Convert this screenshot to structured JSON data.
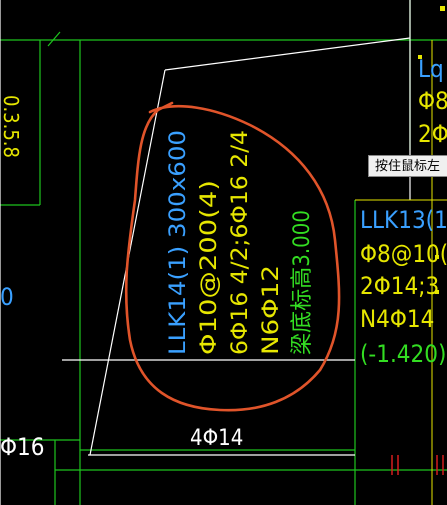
{
  "colors": {
    "background": "#000000",
    "green": "#1ec41e",
    "white": "#ffffff",
    "yellow": "#e6e600",
    "cyan": "#3aa0ff",
    "lime": "#33dd22",
    "orange": "#e0542a",
    "red": "#d21e1e"
  },
  "annotation_main": {
    "line1": "LLK14(1) 300x600",
    "line2": "Φ10@200(4)",
    "line3": "6Φ16 4/2;6Φ16 2/4",
    "line4": "N6Φ12",
    "line5": "梁底标高3.000"
  },
  "annotation_right": {
    "line1": "LLK13(1",
    "line2": "Φ8@10(",
    "line3": "2Φ14;3",
    "line4": "N4Φ14",
    "line5": "(-1.420)"
  },
  "top_right": {
    "line1": "Lq",
    "line2": "Φ8",
    "line3": "2Φ"
  },
  "left_labels": {
    "vertical": "0.3.5.8",
    "zero": "0",
    "bottom": "Φ16"
  },
  "bottom_label": "4Φ14",
  "tooltip": "按住鼠标左"
}
